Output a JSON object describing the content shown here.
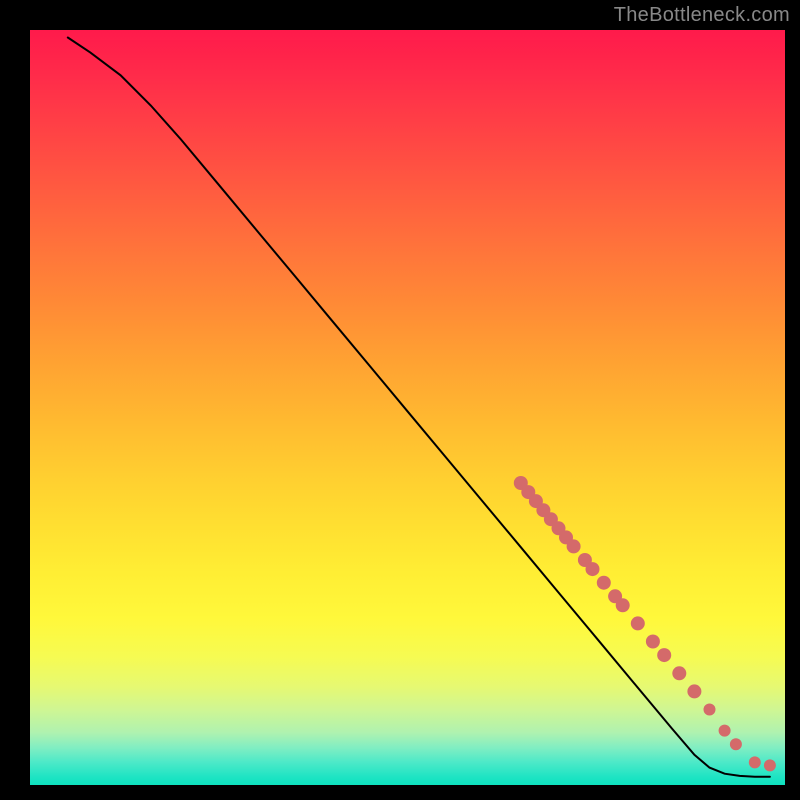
{
  "watermark": "TheBottleneck.com",
  "colors": {
    "gradient_top": "#ff1a4b",
    "gradient_mid": "#ffe031",
    "gradient_bottom": "#0ee1bf",
    "curve": "#000000",
    "marker": "#d46a6a",
    "background": "#000000"
  },
  "chart_data": {
    "type": "line",
    "title": "",
    "xlabel": "",
    "ylabel": "",
    "xlim": [
      0,
      100
    ],
    "ylim": [
      0,
      100
    ],
    "grid": false,
    "legend": false,
    "curve": [
      {
        "x": 5,
        "y": 99
      },
      {
        "x": 8,
        "y": 97
      },
      {
        "x": 12,
        "y": 94
      },
      {
        "x": 16,
        "y": 90
      },
      {
        "x": 20,
        "y": 85.5
      },
      {
        "x": 25,
        "y": 79.5
      },
      {
        "x": 30,
        "y": 73.5
      },
      {
        "x": 35,
        "y": 67.5
      },
      {
        "x": 40,
        "y": 61.5
      },
      {
        "x": 45,
        "y": 55.5
      },
      {
        "x": 50,
        "y": 49.5
      },
      {
        "x": 55,
        "y": 43.5
      },
      {
        "x": 60,
        "y": 37.5
      },
      {
        "x": 65,
        "y": 31.5
      },
      {
        "x": 70,
        "y": 25.5
      },
      {
        "x": 75,
        "y": 19.5
      },
      {
        "x": 80,
        "y": 13.5
      },
      {
        "x": 85,
        "y": 7.5
      },
      {
        "x": 88,
        "y": 4
      },
      {
        "x": 90,
        "y": 2.3
      },
      {
        "x": 92,
        "y": 1.5
      },
      {
        "x": 94,
        "y": 1.2
      },
      {
        "x": 96,
        "y": 1.1
      },
      {
        "x": 98,
        "y": 1.1
      }
    ],
    "markers": [
      {
        "x": 65,
        "y": 40,
        "r": 7
      },
      {
        "x": 66,
        "y": 38.8,
        "r": 7
      },
      {
        "x": 67,
        "y": 37.6,
        "r": 7
      },
      {
        "x": 68,
        "y": 36.4,
        "r": 7
      },
      {
        "x": 69,
        "y": 35.2,
        "r": 7
      },
      {
        "x": 70,
        "y": 34,
        "r": 7
      },
      {
        "x": 71,
        "y": 32.8,
        "r": 7
      },
      {
        "x": 72,
        "y": 31.6,
        "r": 7
      },
      {
        "x": 73.5,
        "y": 29.8,
        "r": 7
      },
      {
        "x": 74.5,
        "y": 28.6,
        "r": 7
      },
      {
        "x": 76,
        "y": 26.8,
        "r": 7
      },
      {
        "x": 77.5,
        "y": 25,
        "r": 7
      },
      {
        "x": 78.5,
        "y": 23.8,
        "r": 7
      },
      {
        "x": 80.5,
        "y": 21.4,
        "r": 7
      },
      {
        "x": 82.5,
        "y": 19,
        "r": 7
      },
      {
        "x": 84,
        "y": 17.2,
        "r": 7
      },
      {
        "x": 86,
        "y": 14.8,
        "r": 7
      },
      {
        "x": 88,
        "y": 12.4,
        "r": 7
      },
      {
        "x": 90,
        "y": 10,
        "r": 6
      },
      {
        "x": 92,
        "y": 7.2,
        "r": 6
      },
      {
        "x": 93.5,
        "y": 5.4,
        "r": 6
      },
      {
        "x": 96,
        "y": 3,
        "r": 6
      },
      {
        "x": 98,
        "y": 2.6,
        "r": 6
      }
    ]
  }
}
